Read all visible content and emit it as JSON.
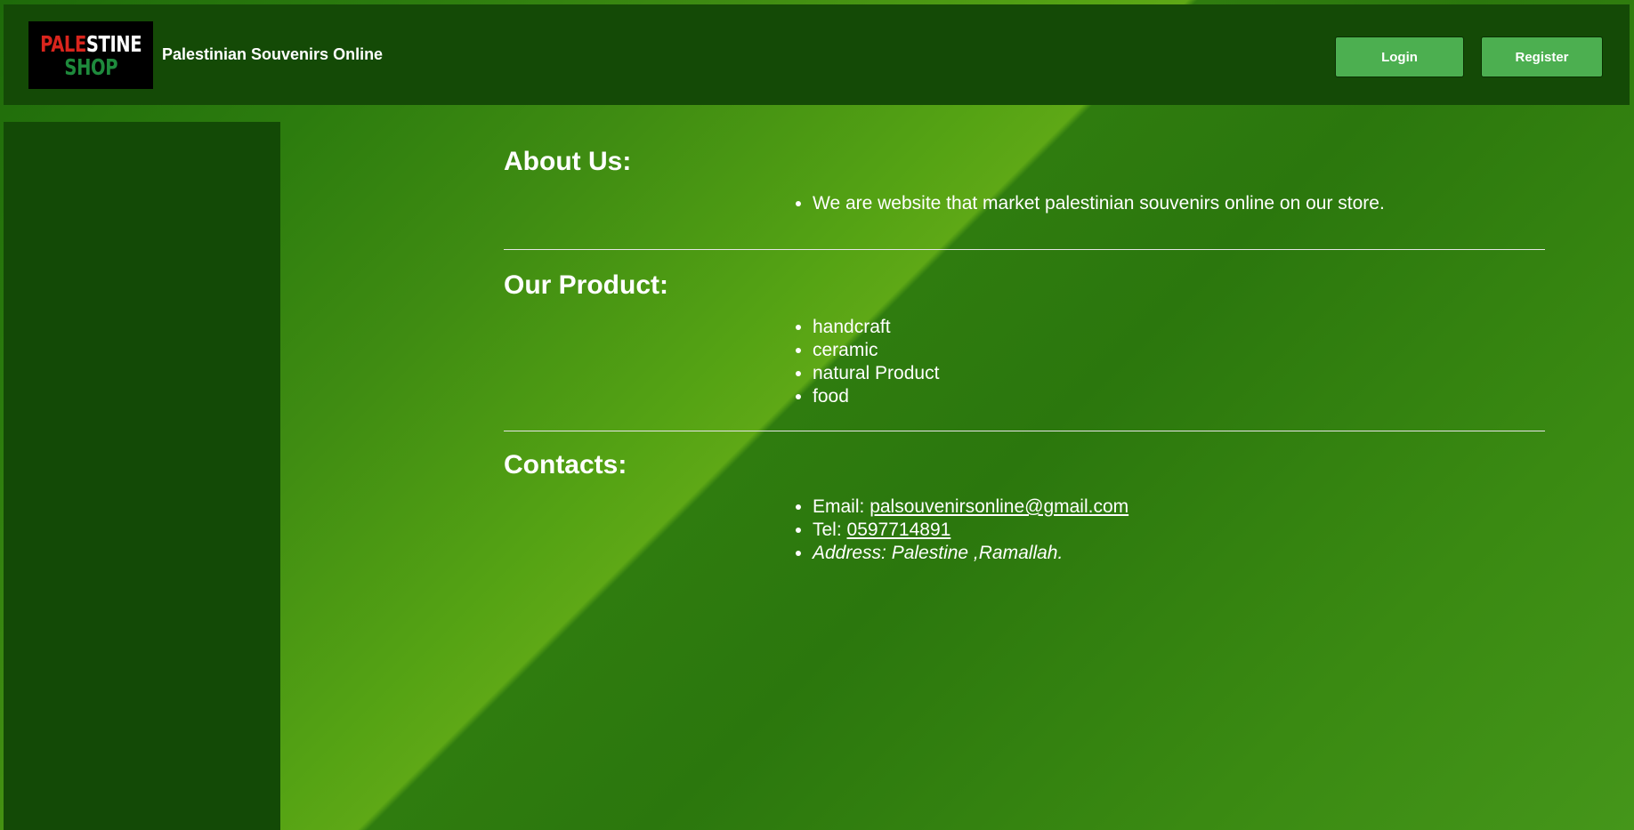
{
  "header": {
    "logo": {
      "text_part1": "PALE",
      "text_part2": "STINE",
      "text_part3": "SHOP"
    },
    "title": "Palestinian Souvenirs Online",
    "login_label": "Login",
    "register_label": "Register"
  },
  "about": {
    "heading": "About Us:",
    "items": [
      "We are website that market palestinian souvenirs online on our store."
    ]
  },
  "products": {
    "heading": "Our Product:",
    "items": [
      "handcraft",
      "ceramic",
      "natural Product",
      "food"
    ]
  },
  "contacts": {
    "heading": "Contacts:",
    "email_label": "Email: ",
    "email_value": "palsouvenirsonline@gmail.com",
    "tel_label": "Tel: ",
    "tel_value": "0597714891",
    "address": "Address: Palestine ,Ramallah."
  },
  "colors": {
    "header_bg": "#144a06",
    "sidebar_bg": "#134a06",
    "button_bg": "#4caf50",
    "logo_red": "#d9251d",
    "logo_green": "#1e8a3c"
  }
}
